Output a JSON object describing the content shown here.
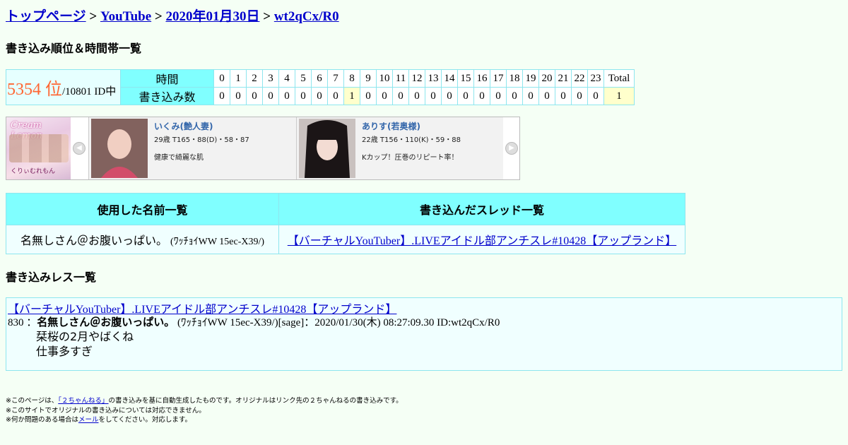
{
  "breadcrumb": {
    "items": [
      "トップページ",
      "YouTube",
      "2020年01月30日",
      "wt2qCx/R0"
    ],
    "separator": ">"
  },
  "headings": {
    "rank_section": "書き込み順位＆時間帯一覧",
    "posts_section": "書き込みレス一覧"
  },
  "rank": {
    "position": "5354 位",
    "of_total": "/10801 ID中",
    "label_hour": "時間",
    "label_count": "書き込み数",
    "hours": [
      "0",
      "1",
      "2",
      "3",
      "4",
      "5",
      "6",
      "7",
      "8",
      "9",
      "10",
      "11",
      "12",
      "13",
      "14",
      "15",
      "16",
      "17",
      "18",
      "19",
      "20",
      "21",
      "22",
      "23"
    ],
    "counts": [
      "0",
      "0",
      "0",
      "0",
      "0",
      "0",
      "0",
      "0",
      "1",
      "0",
      "0",
      "0",
      "0",
      "0",
      "0",
      "0",
      "0",
      "0",
      "0",
      "0",
      "0",
      "0",
      "0",
      "0"
    ],
    "total_label": "Total",
    "total_value": "1",
    "highlight_hour": 8
  },
  "ad": {
    "banner_text": "Cream Lemon",
    "banner_sub": "くりぃむれもん",
    "cards": [
      {
        "name": "いくみ(艶人妻)",
        "spec": "29歳 T165・88(D)・58・87",
        "comment": "健康で綺麗な肌"
      },
      {
        "name": "ありす(若奥様)",
        "spec": "22歳 T156・110(K)・59・88",
        "comment": "Kカップ！圧巻のリピート率！"
      }
    ]
  },
  "names_table": {
    "header_names": "使用した名前一覧",
    "header_threads": "書き込んだスレッド一覧",
    "name": "名無しさん＠お腹いっぱい。",
    "trip": "(ﾜｯﾁｮｲWW 15ec-X39/)",
    "thread": "【バーチャルYouTuber】.LIVEアイドル部アンチスレ#10428【アップランド】"
  },
  "posts": {
    "thread_title": "【バーチャルYouTuber】.LIVEアイドル部アンチスレ#10428【アップランド】",
    "number": "830",
    "colon": "：",
    "name": "名無しさん＠お腹いっぱい。",
    "meta": "(ﾜｯﾁｮｲWW 15ec-X39/)[sage]：2020/01/30(木) 08:27:09.30 ID:wt2qCx/R0",
    "lines": [
      "栞桜の2月やばくね",
      "仕事多すぎ"
    ]
  },
  "footer": {
    "line1_pre": "※このページは、",
    "line1_link": "「２ちゃんねる」",
    "line1_post": "の書き込みを基に自動生成したものです。オリジナルはリンク先の２ちゃんねるの書き込みです。",
    "line2": "※このサイトでオリジナルの書き込みについては対応できません。",
    "line3_pre": "※何か問題のある場合は",
    "line3_link": "メール",
    "line3_post": "をしてください。対応します。"
  },
  "colors": {
    "background": "#f5fff5",
    "cyan_header": "#80ffff",
    "rank_number": "#ff6633",
    "link": "#0000cc",
    "highlight": "#ffffcc"
  }
}
